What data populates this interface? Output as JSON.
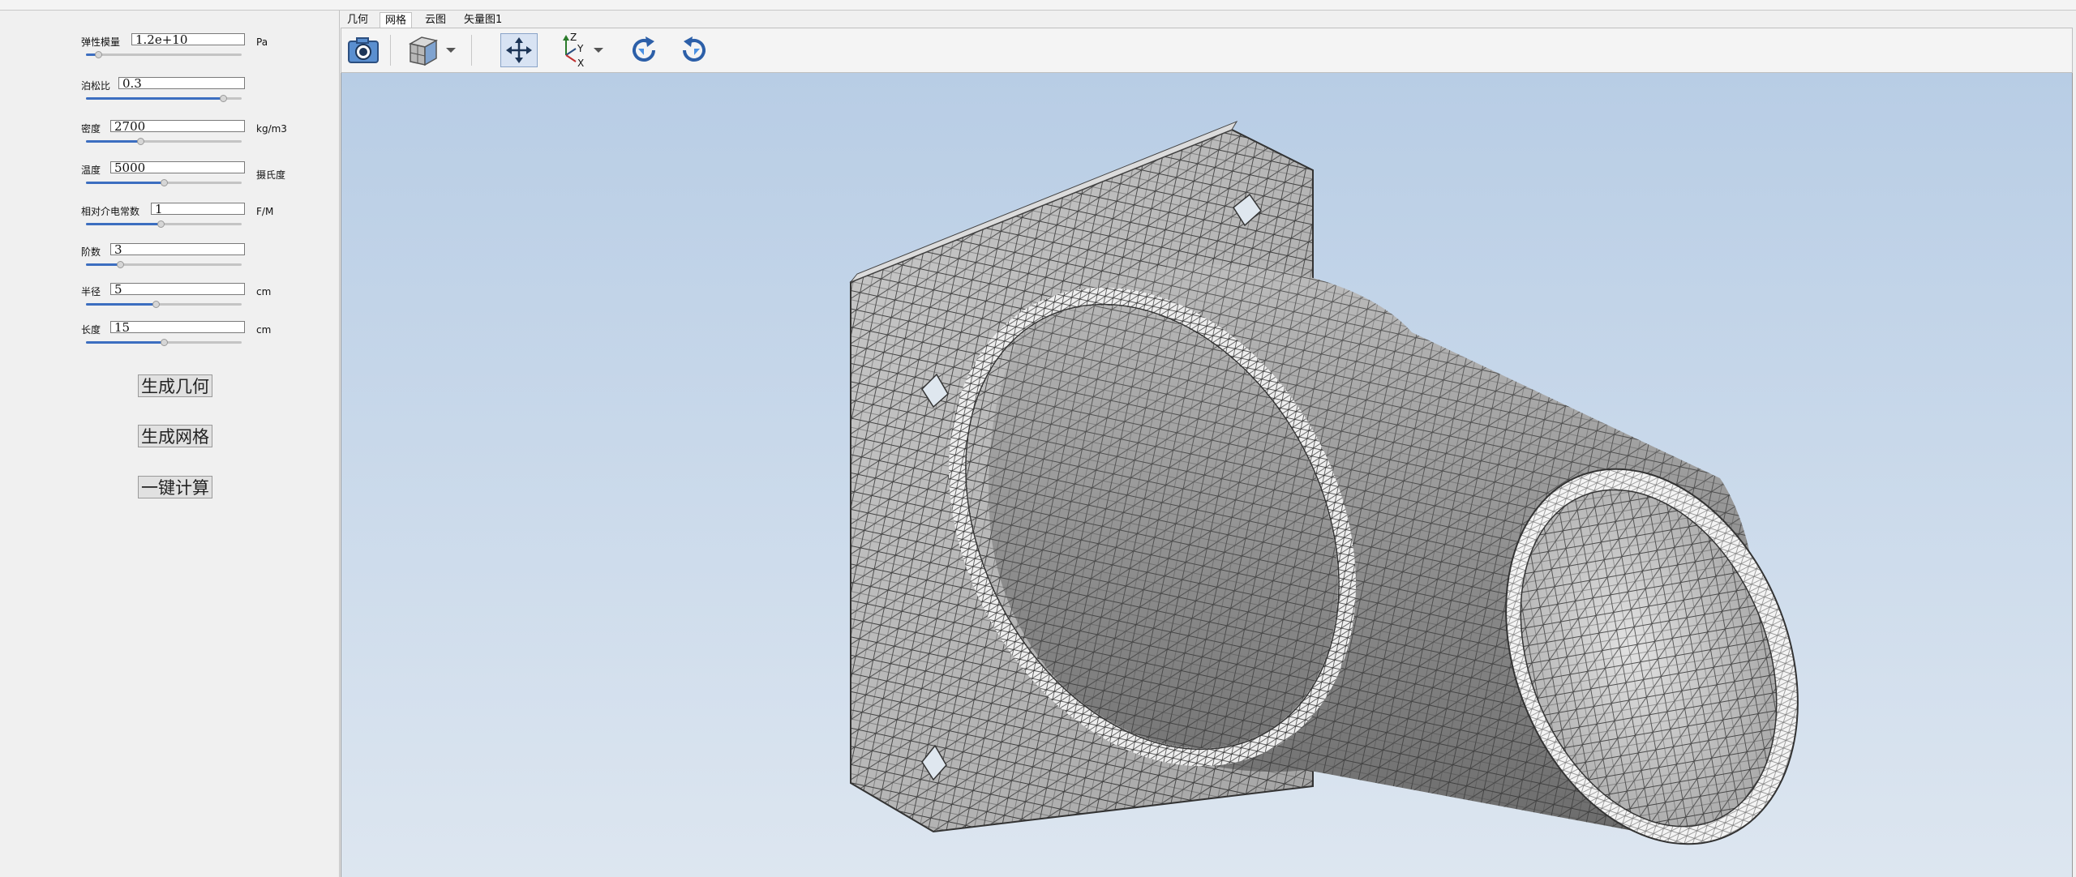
{
  "params": [
    {
      "label": "弹性模量",
      "value": "1.2e+10",
      "unit": "Pa",
      "slider": 0.08
    },
    {
      "label": "泊松比",
      "value": "0.3",
      "unit": "",
      "slider": 0.88
    },
    {
      "label": "密度",
      "value": "2700",
      "unit": "kg/m3",
      "slider": 0.35
    },
    {
      "label": "温度",
      "value": "5000",
      "unit": "摄氏度",
      "slider": 0.5
    },
    {
      "label": "相对介电常数",
      "value": "1",
      "unit": "F/M",
      "slider": 0.48
    },
    {
      "label": "阶数",
      "value": "3",
      "unit": "",
      "slider": 0.22
    },
    {
      "label": "半径",
      "value": "5",
      "unit": "cm",
      "slider": 0.45
    },
    {
      "label": "长度",
      "value": "15",
      "unit": "cm",
      "slider": 0.5
    }
  ],
  "buttons": {
    "gen_geometry": "生成几何",
    "gen_mesh": "生成网格",
    "compute": "一键计算"
  },
  "tabs": [
    "几何",
    "网格",
    "云图",
    "矢量图1"
  ],
  "active_tab": "网格",
  "axis": {
    "z": "Z",
    "y": "Y",
    "x": "X"
  },
  "colors": {
    "accent": "#3c6ec0",
    "viewport_top": "#b8cde5",
    "viewport_bottom": "#dde6f0"
  },
  "icons": [
    "camera-icon",
    "view-cube-icon",
    "dropdown-arrow-icon",
    "fit-view-icon",
    "axes-icon",
    "dropdown-arrow-icon",
    "rotate-cw-icon",
    "rotate-ccw-icon"
  ]
}
